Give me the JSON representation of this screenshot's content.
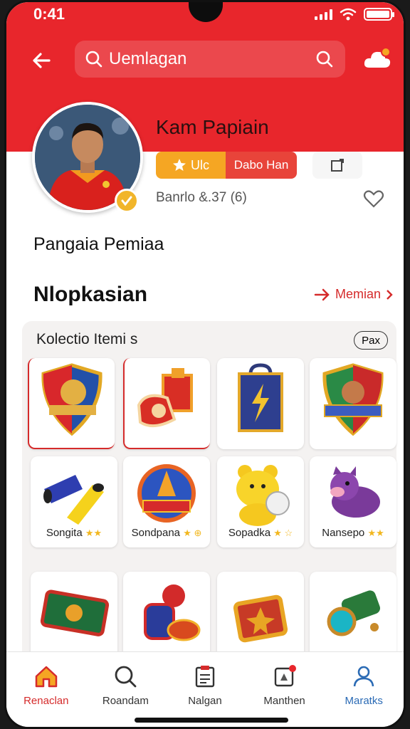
{
  "status_bar": {
    "time": "0:41"
  },
  "header": {
    "back_icon": "arrow-left-icon",
    "search": {
      "value": "Uemlagan",
      "icon": "search-icon"
    },
    "cloud_icon": "cloud-notification-icon",
    "accent_color": "#e8262c"
  },
  "profile": {
    "name": "Kam Papiain",
    "chip_primary": "Ulc",
    "chip_secondary": "Dabo Han",
    "stat": "Banrlo &.37 (6)"
  },
  "section_sub": "Pangaia Pemiaa",
  "section": {
    "title": "Nlopkasian",
    "more_label": "Memian"
  },
  "panel": {
    "title": "Kolectio Itemi s",
    "badge": "Pax",
    "items": [
      {
        "name": "crest-shield-icon",
        "label": ""
      },
      {
        "name": "glove-gift-icon",
        "label": ""
      },
      {
        "name": "lightning-bag-icon",
        "label": ""
      },
      {
        "name": "mascot-crest-icon",
        "label": ""
      },
      {
        "name": "scarf-roll-icon",
        "label": "Songita",
        "stars": "★★"
      },
      {
        "name": "blue-emblem-icon",
        "label": "Sondpana",
        "stars": "★ ⊕"
      },
      {
        "name": "yellow-bear-icon",
        "label": "Sopadka",
        "stars": "★ ☆"
      },
      {
        "name": "purple-creature-icon",
        "label": "Nansepo",
        "stars": "★★"
      },
      {
        "name": "green-ticket-icon",
        "label": ""
      },
      {
        "name": "drum-toy-icon",
        "label": ""
      },
      {
        "name": "gold-chest-icon",
        "label": ""
      },
      {
        "name": "green-telescope-icon",
        "label": ""
      }
    ]
  },
  "bottom_nav": [
    {
      "label": "Renaclan",
      "icon": "home-icon"
    },
    {
      "label": "Roandam",
      "icon": "search-icon"
    },
    {
      "label": "Nalgan",
      "icon": "clipboard-icon"
    },
    {
      "label": "Manthen",
      "icon": "notification-icon"
    },
    {
      "label": "Maratks",
      "icon": "user-icon"
    }
  ]
}
